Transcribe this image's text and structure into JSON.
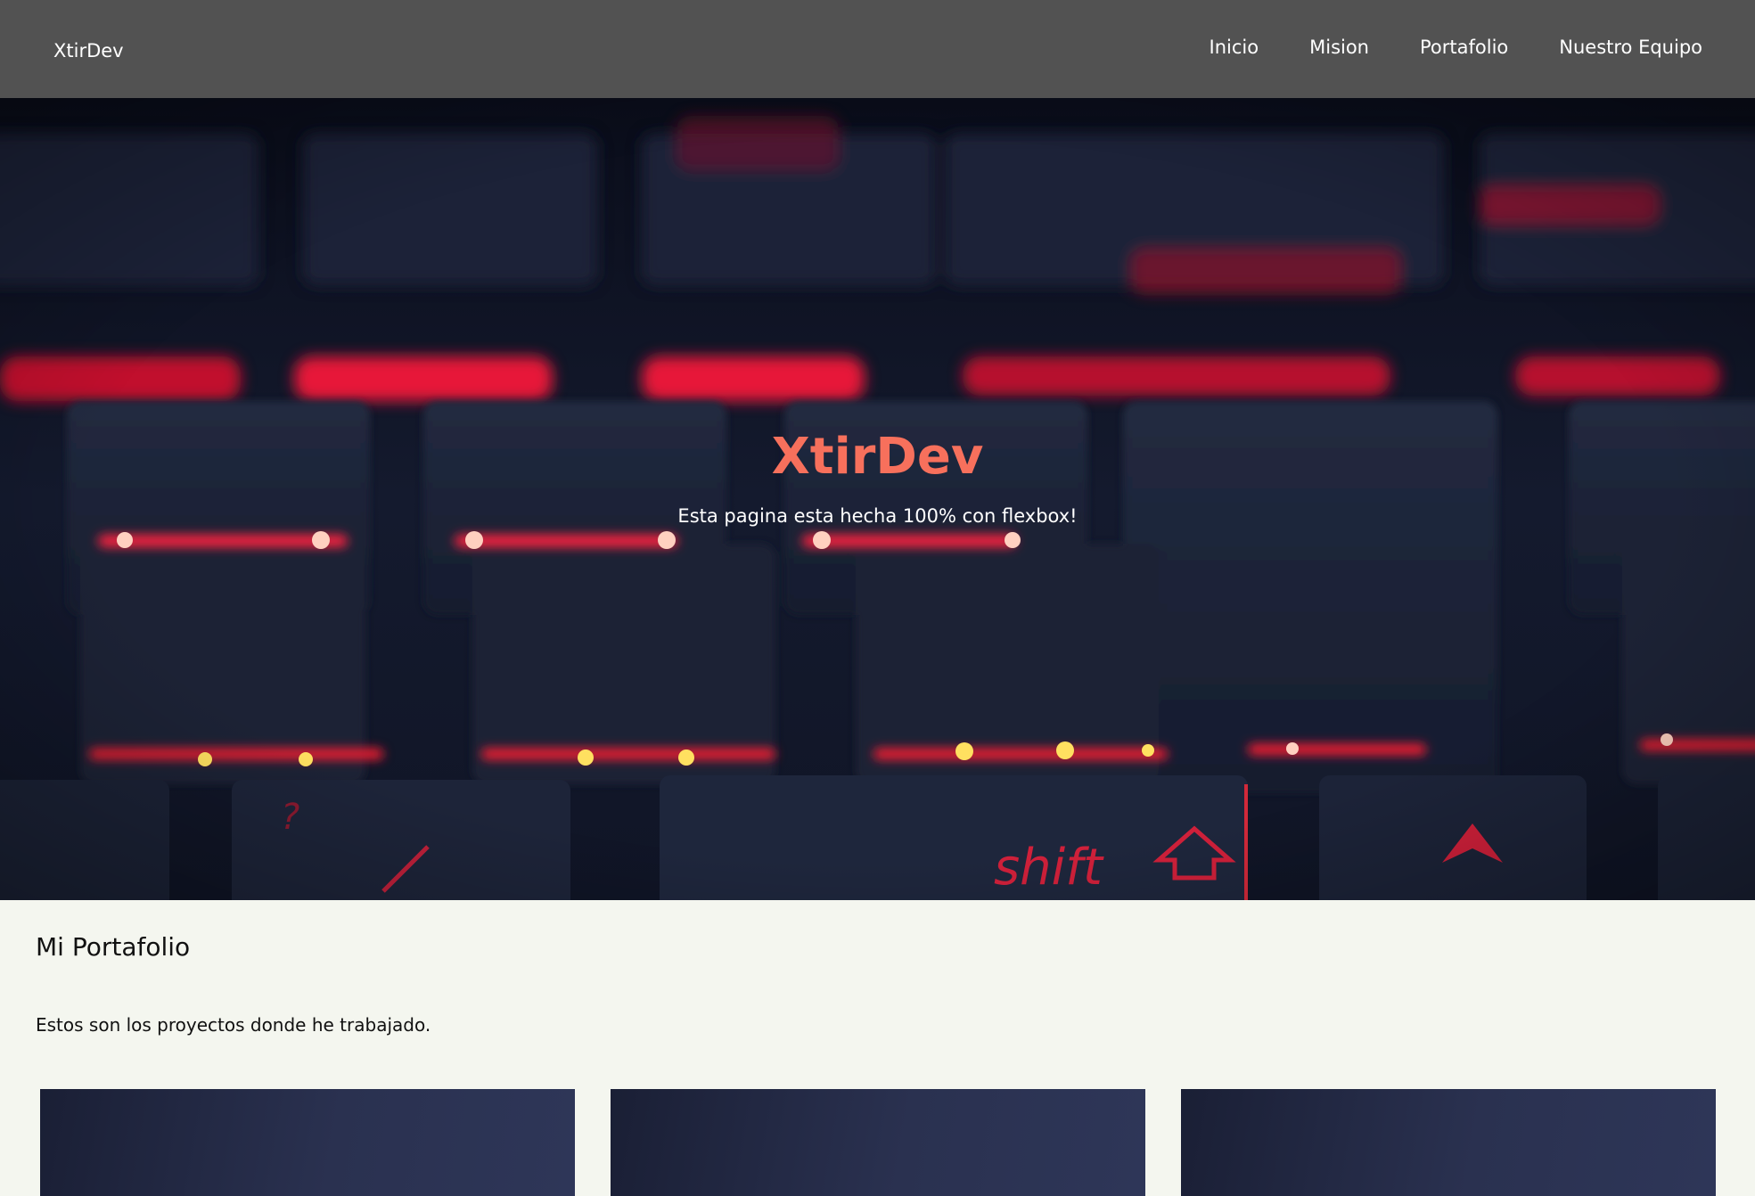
{
  "navbar": {
    "brand": "XtirDev",
    "links": [
      {
        "label": "Inicio"
      },
      {
        "label": "Mision"
      },
      {
        "label": "Portafolio"
      },
      {
        "label": "Nuestro Equipo"
      }
    ],
    "background": "#525252"
  },
  "hero": {
    "title": "XtirDev",
    "subtitle": "Esta pagina esta hecha 100% con flexbox!",
    "title_color": "#f7705c",
    "background_image": "backlit-keyboard-red"
  },
  "portfolio": {
    "title": "Mi Portafolio",
    "description": "Estos son los proyectos donde he trabajado.",
    "project_count_visible": 3
  }
}
